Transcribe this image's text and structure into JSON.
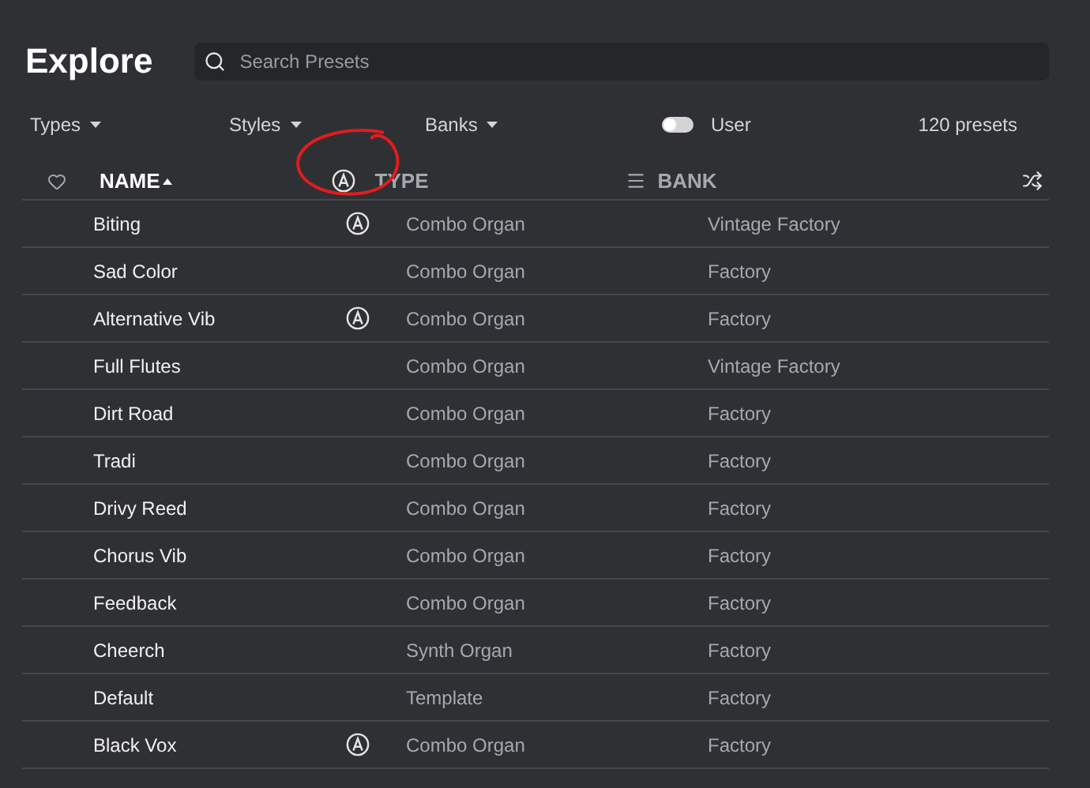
{
  "title": "Explore",
  "search": {
    "placeholder": "Search Presets"
  },
  "filters": [
    "Types",
    "Styles",
    "Banks"
  ],
  "user_toggle": {
    "label": "User",
    "on": false
  },
  "count": "120 presets",
  "columns": {
    "name": "NAME",
    "type": "TYPE",
    "bank": "BANK"
  },
  "rows": [
    {
      "name": "Biting",
      "artist": true,
      "type": "Combo Organ",
      "bank": "Vintage Factory"
    },
    {
      "name": "Sad Color",
      "artist": false,
      "type": "Combo Organ",
      "bank": "Factory"
    },
    {
      "name": "Alternative Vib",
      "artist": true,
      "type": "Combo Organ",
      "bank": "Factory"
    },
    {
      "name": "Full Flutes",
      "artist": false,
      "type": "Combo Organ",
      "bank": "Vintage Factory"
    },
    {
      "name": "Dirt Road",
      "artist": false,
      "type": "Combo Organ",
      "bank": "Factory"
    },
    {
      "name": "Tradi",
      "artist": false,
      "type": "Combo Organ",
      "bank": "Factory"
    },
    {
      "name": "Drivy Reed",
      "artist": false,
      "type": "Combo Organ",
      "bank": "Factory"
    },
    {
      "name": "Chorus Vib",
      "artist": false,
      "type": "Combo Organ",
      "bank": "Factory"
    },
    {
      "name": "Feedback",
      "artist": false,
      "type": "Combo Organ",
      "bank": "Factory"
    },
    {
      "name": "Cheerch",
      "artist": false,
      "type": "Synth Organ",
      "bank": "Factory"
    },
    {
      "name": "Default",
      "artist": false,
      "type": "Template",
      "bank": "Factory"
    },
    {
      "name": "Black Vox",
      "artist": true,
      "type": "Combo Organ",
      "bank": "Factory"
    }
  ]
}
